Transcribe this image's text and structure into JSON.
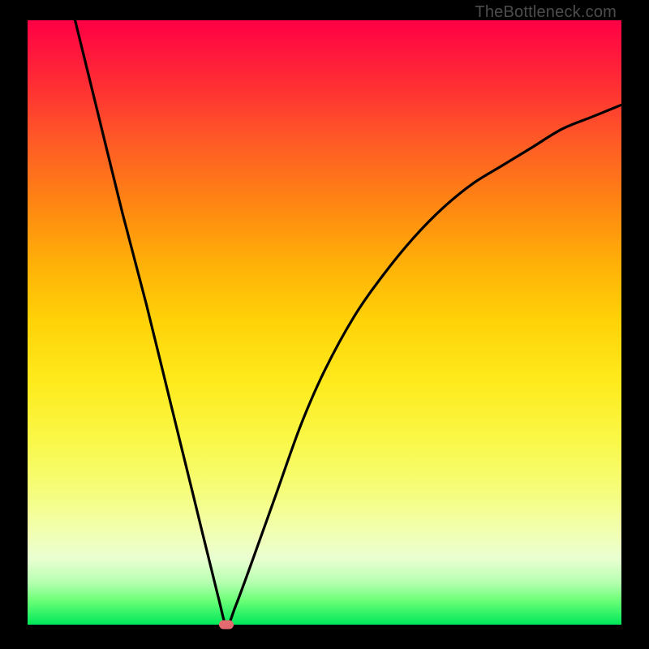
{
  "watermark": "TheBottleneck.com",
  "colors": {
    "frame": "#000000",
    "curve": "#000000",
    "marker": "#e46a6f"
  },
  "chart_data": {
    "type": "line",
    "title": "",
    "xlabel": "",
    "ylabel": "",
    "xlim": [
      0,
      100
    ],
    "ylim": [
      0,
      100
    ],
    "grid": false,
    "legend": false,
    "annotations": [
      "TheBottleneck.com"
    ],
    "series": [
      {
        "name": "bottleneck-curve",
        "x": [
          8,
          12,
          16,
          20,
          24,
          28,
          32,
          33.5,
          35,
          38,
          42,
          46,
          50,
          55,
          60,
          65,
          70,
          75,
          80,
          85,
          90,
          95,
          100
        ],
        "y": [
          100,
          84,
          68,
          53,
          37,
          21,
          5,
          0,
          3,
          11,
          22,
          33,
          42,
          51,
          58,
          64,
          69,
          73,
          76,
          79,
          82,
          84,
          86
        ]
      }
    ],
    "marker": {
      "x": 33.5,
      "y": 0
    },
    "background_gradient": {
      "top": "#ff0045",
      "mid": "#ffd308",
      "bottom": "#00e85a"
    }
  }
}
